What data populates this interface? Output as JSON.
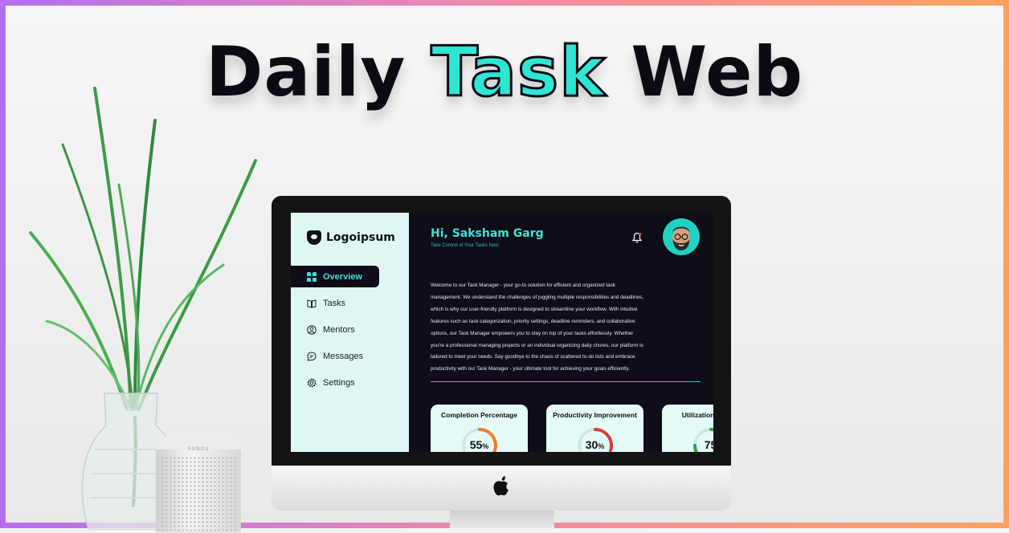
{
  "hero": {
    "title_part1": "Daily",
    "title_accent": "Task",
    "title_part2": "Web"
  },
  "speaker": {
    "brand": "SONOS"
  },
  "app": {
    "logo_text": "Logoipsum",
    "nav": [
      {
        "label": "Overview",
        "icon": "grid-icon",
        "active": true
      },
      {
        "label": "Tasks",
        "icon": "book-icon",
        "active": false
      },
      {
        "label": "Mentors",
        "icon": "user-circle-icon",
        "active": false
      },
      {
        "label": "Messages",
        "icon": "message-icon",
        "active": false
      },
      {
        "label": "Settings",
        "icon": "gear-icon",
        "active": false
      }
    ],
    "greeting": "Hi, Saksham Garg",
    "tagline": "Take Control of Your Tasks Now",
    "intro_lines": [
      "Welcome to our Task Manager - your go-to solution for efficient and organized task",
      "management. We understand the challenges of juggling multiple responsibilities and deadlines,",
      "which is why our user-friendly platform is designed to streamline your workflow. With intuitive",
      "features such as task categorization, priority settings, deadline reminders, and collaborative",
      "options, our Task Manager empowers you to stay on top of your tasks effortlessly. Whether",
      "you're a professional managing projects or an individual organizing daily chores, our platform is",
      "tailored to meet your needs. Say goodbye to the chaos of scattered to-do lists and embrace",
      "productivity with our Task Manager - your ultimate tool for achieving your goals efficiently."
    ],
    "cards": [
      {
        "title": "Completion Percentage",
        "value": "55",
        "unit": "%",
        "fraction": 0.55,
        "color": "#f07a2a"
      },
      {
        "title": "Productivity Improvement",
        "value": "30",
        "unit": "%",
        "fraction": 0.3,
        "color": "#e53935"
      },
      {
        "title": "Utilization App Fe",
        "value": "75",
        "unit": "",
        "fraction": 0.75,
        "color": "#2e9e4f"
      }
    ],
    "colors": {
      "accent": "#3fe1d5",
      "dark": "#0f0d18",
      "sidebar": "#dff7f4"
    }
  }
}
